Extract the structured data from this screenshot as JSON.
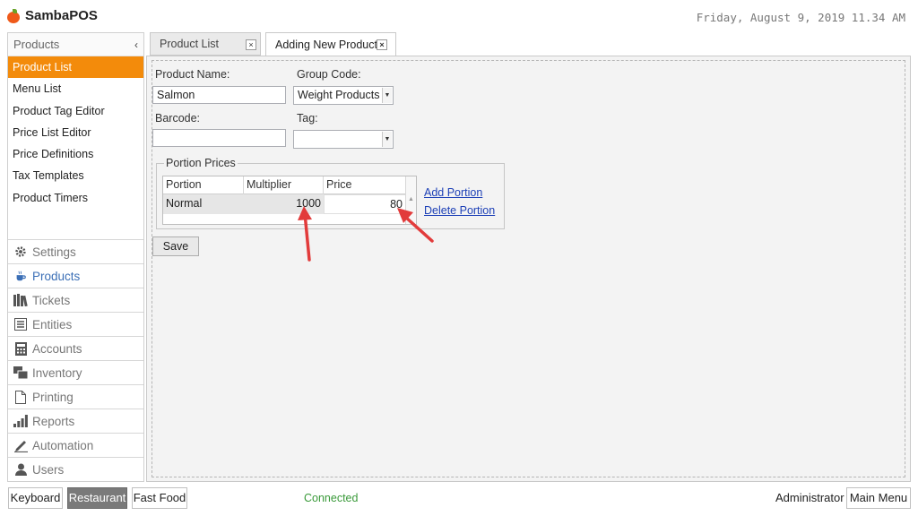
{
  "app": {
    "name": "SambaPOS",
    "datetime": "Friday, August 9, 2019 11.34 AM"
  },
  "sidebar": {
    "header": "Products",
    "collapse_icon": "‹",
    "items": [
      {
        "label": "Product List",
        "active": true
      },
      {
        "label": "Menu List"
      },
      {
        "label": "Product Tag Editor"
      },
      {
        "label": "Price List Editor"
      },
      {
        "label": "Price Definitions"
      },
      {
        "label": "Tax Templates"
      },
      {
        "label": "Product Timers"
      }
    ],
    "categories": [
      {
        "label": "Settings",
        "icon": "gear-icon"
      },
      {
        "label": "Products",
        "icon": "coffee-cup-icon",
        "active": true
      },
      {
        "label": "Tickets",
        "icon": "books-icon"
      },
      {
        "label": "Entities",
        "icon": "list-icon"
      },
      {
        "label": "Accounts",
        "icon": "calculator-icon"
      },
      {
        "label": "Inventory",
        "icon": "windows-icon"
      },
      {
        "label": "Printing",
        "icon": "document-icon"
      },
      {
        "label": "Reports",
        "icon": "bar-chart-icon"
      },
      {
        "label": "Automation",
        "icon": "pen-icon"
      },
      {
        "label": "Users",
        "icon": "user-icon"
      }
    ]
  },
  "tabs": [
    {
      "label": "Product List",
      "close": "×"
    },
    {
      "label": "Adding New Product",
      "close": "×"
    }
  ],
  "form": {
    "product_name_label": "Product Name:",
    "product_name_value": "Salmon",
    "group_code_label": "Group Code:",
    "group_code_value": "Weight Products",
    "barcode_label": "Barcode:",
    "barcode_value": "",
    "tag_label": "Tag:",
    "tag_value": "",
    "portion_prices": {
      "legend": "Portion Prices",
      "columns": [
        "Portion",
        "Multiplier",
        "Price"
      ],
      "rows": [
        {
          "portion": "Normal",
          "multiplier": "1000",
          "price": "80"
        }
      ]
    },
    "add_portion": "Add Portion",
    "delete_portion": "Delete Portion",
    "save": "Save"
  },
  "footer": {
    "keyboard": "Keyboard",
    "restaurant": "Restaurant",
    "fast_food": "Fast Food",
    "status": "Connected",
    "user": "Administrator",
    "main_menu": "Main Menu"
  },
  "colors": {
    "accent": "#f38b0b",
    "link": "#1c3fb6",
    "status_ok": "#3a9a3a",
    "annotation_arrow": "#e23b3b"
  }
}
